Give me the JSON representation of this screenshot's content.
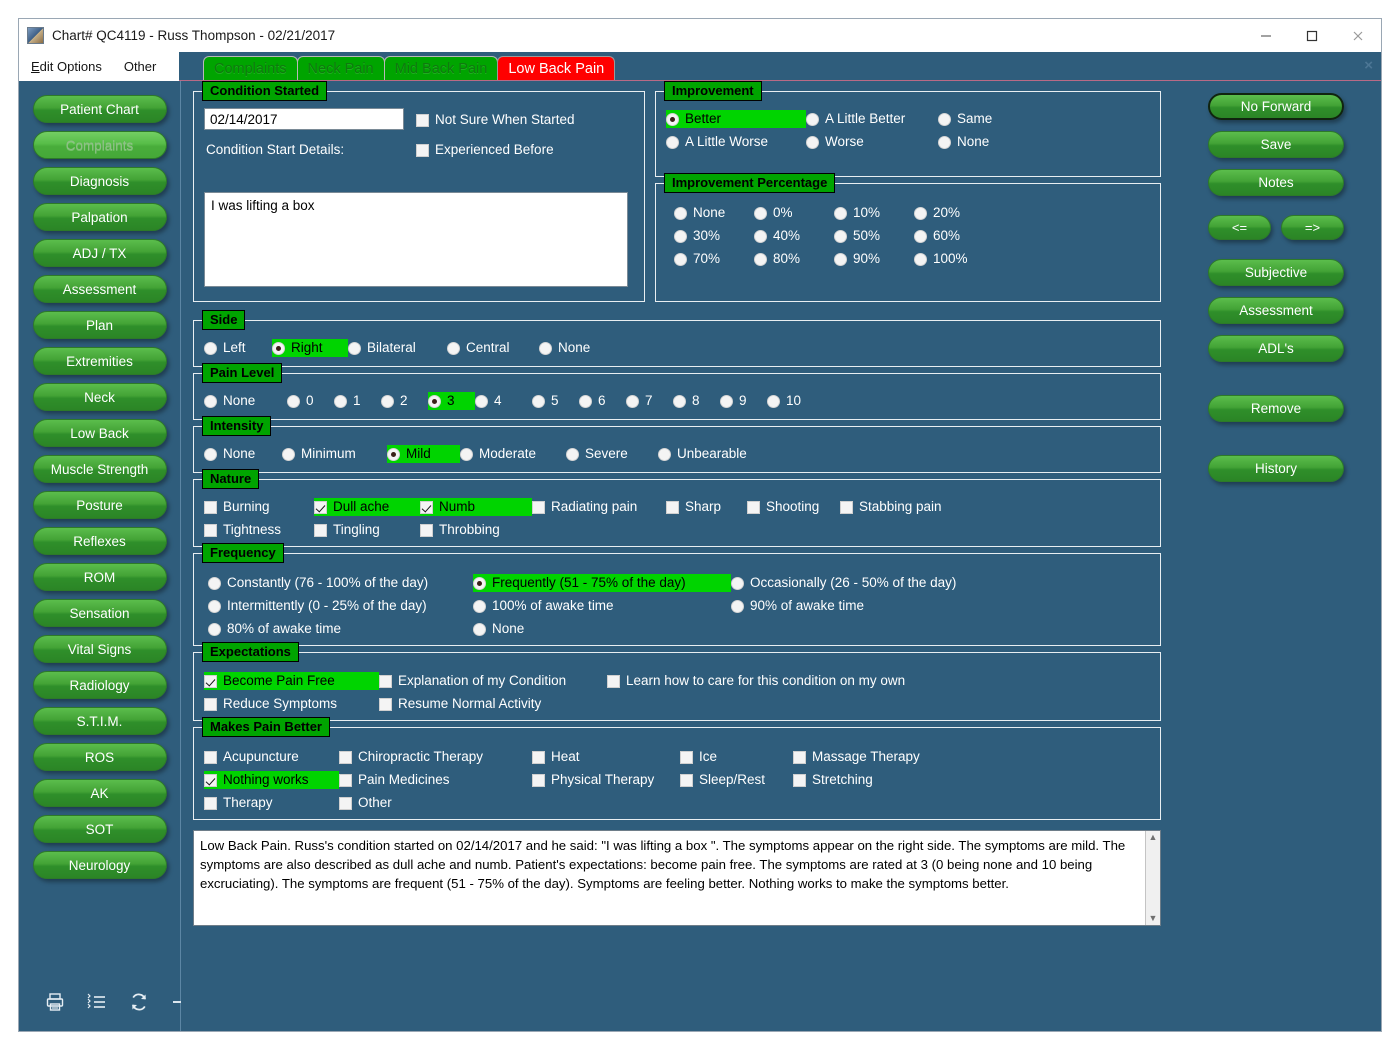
{
  "window": {
    "title": "Chart# QC4119 - Russ Thompson - 02/21/2017",
    "minimize_label": "minimize",
    "maximize_label": "maximize",
    "close_label": "close"
  },
  "menubar": {
    "items": [
      {
        "label": "Edit Options",
        "mnemonic": "E",
        "rest": "dit Options"
      },
      {
        "label": "Other",
        "mnemonic": "",
        "rest": "Other"
      }
    ]
  },
  "tabs": {
    "items": [
      {
        "label": "Complaints",
        "active": false
      },
      {
        "label": "Neck Pain",
        "active": false
      },
      {
        "label": "Mid Back Pain",
        "active": false
      },
      {
        "label": "Low Back Pain",
        "active": true
      }
    ],
    "close_label": "×"
  },
  "sidebar": {
    "items": [
      {
        "label": "Patient Chart",
        "disabled": false
      },
      {
        "label": "Complaints",
        "disabled": true
      },
      {
        "label": "Diagnosis",
        "disabled": false
      },
      {
        "label": "Palpation",
        "disabled": false
      },
      {
        "label": "ADJ / TX",
        "disabled": false
      },
      {
        "label": "Assessment",
        "disabled": false
      },
      {
        "label": "Plan",
        "disabled": false
      },
      {
        "label": "Extremities",
        "disabled": false
      },
      {
        "label": "Neck",
        "disabled": false
      },
      {
        "label": "Low Back",
        "disabled": false
      },
      {
        "label": "Muscle Strength",
        "disabled": false
      },
      {
        "label": "Posture",
        "disabled": false
      },
      {
        "label": "Reflexes",
        "disabled": false
      },
      {
        "label": "ROM",
        "disabled": false
      },
      {
        "label": "Sensation",
        "disabled": false
      },
      {
        "label": "Vital Signs",
        "disabled": false
      },
      {
        "label": "Radiology",
        "disabled": false
      },
      {
        "label": "S.T.I.M.",
        "disabled": false
      },
      {
        "label": "ROS",
        "disabled": false
      },
      {
        "label": "AK",
        "disabled": false
      },
      {
        "label": "SOT",
        "disabled": false
      },
      {
        "label": "Neurology",
        "disabled": false
      }
    ],
    "tools": [
      {
        "name": "print-icon"
      },
      {
        "name": "list-icon"
      },
      {
        "name": "refresh-icon"
      },
      {
        "name": "arrow-right-icon"
      }
    ]
  },
  "form": {
    "condition_started": {
      "title": "Condition Started",
      "date_value": "02/14/2017",
      "details_label": "Condition Start Details:",
      "details_value": "I was lifting a box",
      "checks": [
        {
          "label": "Not Sure When Started",
          "checked": false
        },
        {
          "label": "Experienced Before",
          "checked": false
        }
      ]
    },
    "improvement": {
      "title": "Improvement",
      "options": [
        {
          "label": "Better",
          "selected": true
        },
        {
          "label": "A Little Better",
          "selected": false
        },
        {
          "label": "Same",
          "selected": false
        },
        {
          "label": "A Little Worse",
          "selected": false
        },
        {
          "label": "Worse",
          "selected": false
        },
        {
          "label": "None",
          "selected": false
        }
      ]
    },
    "improvement_percentage": {
      "title": "Improvement Percentage",
      "options": [
        {
          "label": "None",
          "selected": false
        },
        {
          "label": "0%",
          "selected": false
        },
        {
          "label": "10%",
          "selected": false
        },
        {
          "label": "20%",
          "selected": false
        },
        {
          "label": "30%",
          "selected": false
        },
        {
          "label": "40%",
          "selected": false
        },
        {
          "label": "50%",
          "selected": false
        },
        {
          "label": "60%",
          "selected": false
        },
        {
          "label": "70%",
          "selected": false
        },
        {
          "label": "80%",
          "selected": false
        },
        {
          "label": "90%",
          "selected": false
        },
        {
          "label": "100%",
          "selected": false
        }
      ]
    },
    "side": {
      "title": "Side",
      "options": [
        {
          "label": "Left",
          "selected": false
        },
        {
          "label": "Right",
          "selected": true
        },
        {
          "label": "Bilateral",
          "selected": false
        },
        {
          "label": "Central",
          "selected": false
        },
        {
          "label": "None",
          "selected": false
        }
      ]
    },
    "pain_level": {
      "title": "Pain Level",
      "options": [
        {
          "label": "None",
          "selected": false
        },
        {
          "label": "0",
          "selected": false
        },
        {
          "label": "1",
          "selected": false
        },
        {
          "label": "2",
          "selected": false
        },
        {
          "label": "3",
          "selected": true
        },
        {
          "label": "4",
          "selected": false
        },
        {
          "label": "5",
          "selected": false
        },
        {
          "label": "6",
          "selected": false
        },
        {
          "label": "7",
          "selected": false
        },
        {
          "label": "8",
          "selected": false
        },
        {
          "label": "9",
          "selected": false
        },
        {
          "label": "10",
          "selected": false
        }
      ]
    },
    "intensity": {
      "title": "Intensity",
      "options": [
        {
          "label": "None",
          "selected": false
        },
        {
          "label": "Minimum",
          "selected": false
        },
        {
          "label": "Mild",
          "selected": true
        },
        {
          "label": "Moderate",
          "selected": false
        },
        {
          "label": "Severe",
          "selected": false
        },
        {
          "label": "Unbearable",
          "selected": false
        }
      ]
    },
    "nature": {
      "title": "Nature",
      "row1": [
        {
          "label": "Burning",
          "checked": false
        },
        {
          "label": "Dull ache",
          "checked": true
        },
        {
          "label": "Numb",
          "checked": true
        },
        {
          "label": "Radiating pain",
          "checked": false
        },
        {
          "label": "Sharp",
          "checked": false
        },
        {
          "label": "Shooting",
          "checked": false
        },
        {
          "label": "Stabbing pain",
          "checked": false
        }
      ],
      "row2": [
        {
          "label": "Tightness",
          "checked": false
        },
        {
          "label": "Tingling",
          "checked": false
        },
        {
          "label": "Throbbing",
          "checked": false
        }
      ]
    },
    "frequency": {
      "title": "Frequency",
      "row1": [
        {
          "label": "Constantly (76 - 100% of the day)",
          "selected": false
        },
        {
          "label": "Frequently (51 - 75% of the day)",
          "selected": true
        },
        {
          "label": "Occasionally (26 - 50% of the day)",
          "selected": false
        }
      ],
      "row2": [
        {
          "label": "Intermittently (0 - 25% of the day)",
          "selected": false
        },
        {
          "label": "100% of awake time",
          "selected": false
        },
        {
          "label": "90% of awake time",
          "selected": false
        }
      ],
      "row3": [
        {
          "label": "80% of awake time",
          "selected": false
        },
        {
          "label": "None",
          "selected": false
        }
      ]
    },
    "expectations": {
      "title": "Expectations",
      "row1": [
        {
          "label": "Become Pain Free",
          "checked": true
        },
        {
          "label": "Explanation of my Condition",
          "checked": false
        },
        {
          "label": "Learn how to care for this condition on my own",
          "checked": false
        }
      ],
      "row2": [
        {
          "label": "Reduce Symptoms",
          "checked": false
        },
        {
          "label": "Resume Normal Activity",
          "checked": false
        }
      ]
    },
    "makes_pain_better": {
      "title": "Makes Pain Better",
      "row1": [
        {
          "label": "Acupuncture",
          "checked": false
        },
        {
          "label": "Chiropractic Therapy",
          "checked": false
        },
        {
          "label": "Heat",
          "checked": false
        },
        {
          "label": "Ice",
          "checked": false
        },
        {
          "label": "Massage Therapy",
          "checked": false
        }
      ],
      "row2": [
        {
          "label": "Nothing works",
          "checked": true
        },
        {
          "label": "Pain Medicines",
          "checked": false
        },
        {
          "label": "Physical Therapy",
          "checked": false
        },
        {
          "label": "Sleep/Rest",
          "checked": false
        },
        {
          "label": "Stretching",
          "checked": false
        }
      ],
      "row3": [
        {
          "label": "Therapy",
          "checked": false
        },
        {
          "label": "Other",
          "checked": false
        }
      ]
    },
    "summary": {
      "text": "Low Back Pain.  Russ's condition started on 02/14/2017 and he said: \"I was lifting a box \".  The symptoms appear on the right side.  The symptoms are mild.  The symptoms are also described as dull ache and numb.  Patient's expectations: become pain free.  The symptoms are rated at 3 (0 being none and 10 being excruciating).  The symptoms are frequent (51 - 75% of the day).  Symptoms are feeling better.  Nothing works to make the symptoms better."
    }
  },
  "actions": {
    "buttons": [
      {
        "label": "No Forward",
        "focused": true
      },
      {
        "label": "Save",
        "focused": false
      },
      {
        "label": "Notes",
        "focused": false
      }
    ],
    "prev_label": "<=",
    "next_label": "=>",
    "group2": [
      {
        "label": "Subjective"
      },
      {
        "label": "Assessment"
      },
      {
        "label": "ADL's"
      }
    ],
    "remove_label": "Remove",
    "history_label": "History"
  },
  "colors": {
    "window_bg": "#2f5d7c",
    "accent_green": "#00a400",
    "highlight_green": "#00d400",
    "active_tab_red": "#ff0000",
    "button_green": "#43a336"
  }
}
